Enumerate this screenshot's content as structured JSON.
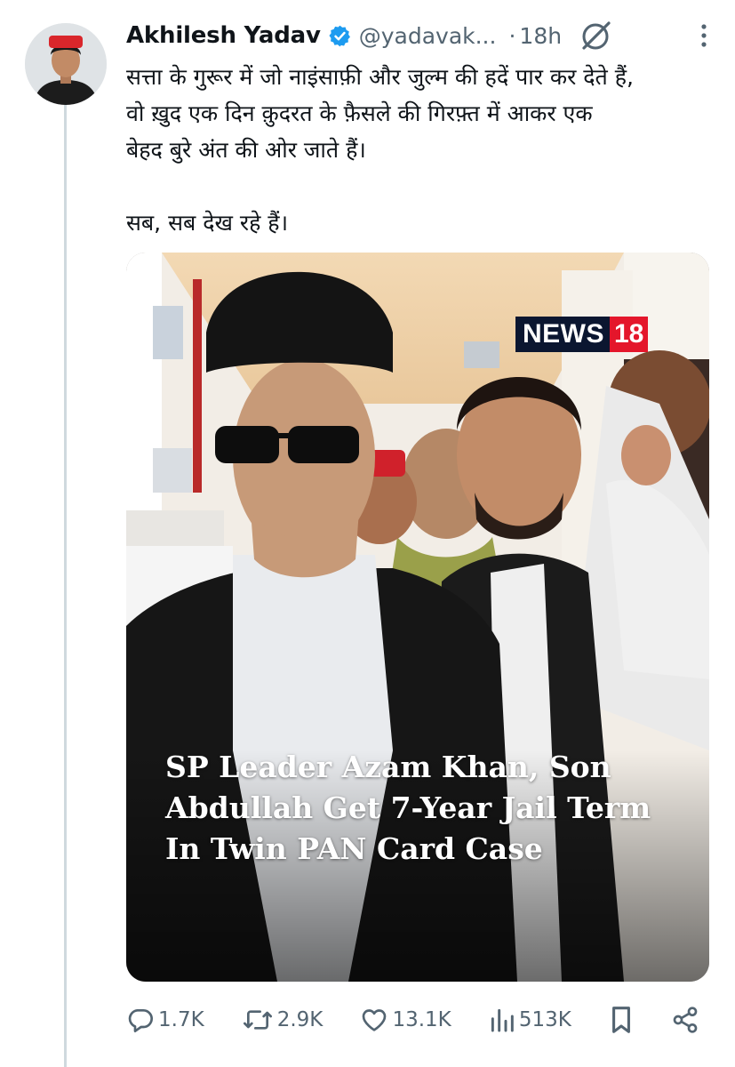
{
  "tweet": {
    "author_name": "Akhilesh Yadav",
    "handle": "@yadavak...",
    "separator": "·",
    "time": "18h",
    "text_lines": [
      "सत्ता के गुरूर में जो नाइंसाफ़ी और जुल्म की हदें पार कर देते हैं,",
      "वो ख़ुद एक दिन क़ुदरत के फ़ैसले की गिरफ़्त में आकर एक",
      "बेहद बुरे अंत की ओर जाते हैं।",
      "सब, सब देख रहे हैं।"
    ]
  },
  "media": {
    "logo_text": "NEWS",
    "logo_number": "18",
    "headline_lines": [
      "SP Leader Azam Khan, Son",
      "Abdullah Get 7-Year Jail Term",
      "In Twin PAN Card Case"
    ]
  },
  "actions": {
    "replies": "1.7K",
    "reposts": "2.9K",
    "likes": "13.1K",
    "views": "513K"
  },
  "icons": {
    "verified": "verified-badge-icon",
    "grok": "grok-icon",
    "more": "more-vertical-icon",
    "reply": "reply-icon",
    "repost": "repost-icon",
    "like": "heart-icon",
    "views": "views-chart-icon",
    "bookmark": "bookmark-icon",
    "share": "share-icon"
  },
  "colors": {
    "verified_blue": "#1d9bf0",
    "muted_text": "#536471",
    "logo_red": "#e4162b",
    "logo_navy": "#0b1630"
  }
}
